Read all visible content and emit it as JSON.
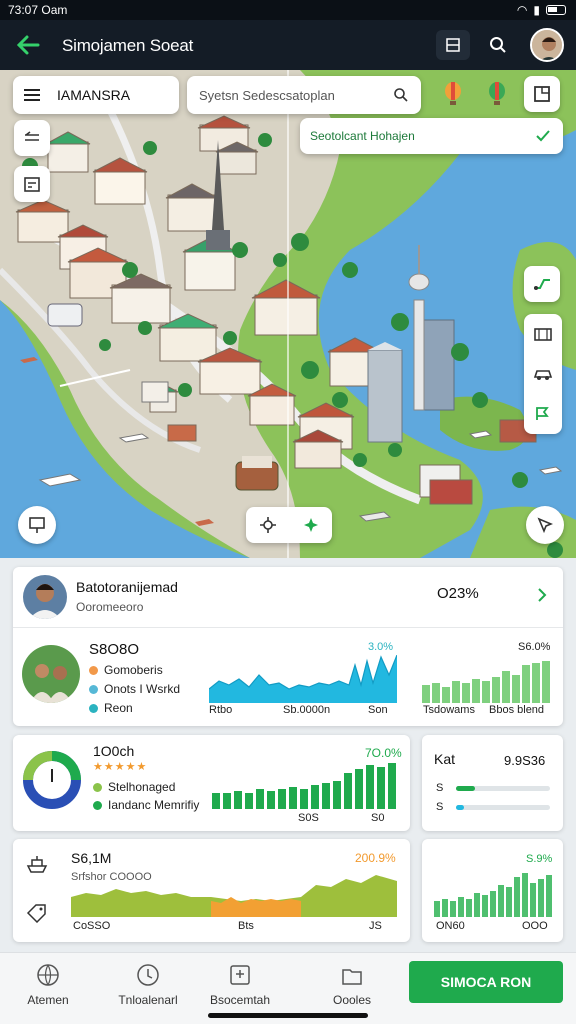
{
  "status_bar": {
    "time": "73:07 Oam",
    "icons": [
      "wifi-icon",
      "signal-icon",
      "battery-icon"
    ]
  },
  "app_bar": {
    "title": "Simojamen Soeat"
  },
  "map": {
    "location_chip": "IAMANSRA",
    "search_placeholder": "Syetsn Sedescsatoplan",
    "notice": "Seotolcant Hohajen"
  },
  "card_profile": {
    "name": "Batotoranijemad",
    "subtitle": "Ooromeeoro",
    "value": "O23%"
  },
  "card_sales": {
    "title": "S8O8O",
    "legend": [
      {
        "label": "Gomoberis",
        "color": "#f2994a"
      },
      {
        "label": "Onots I Wsrkd",
        "color": "#56b8d6"
      },
      {
        "label": "Reon",
        "color": "#2bb3c0"
      }
    ],
    "chart_value": "3.0%",
    "axis": [
      "Rtbo",
      "Sb.0000n",
      "Son"
    ],
    "right_value": "S6.0%",
    "right_axis": [
      "Tsdowams",
      "Bbos blend"
    ]
  },
  "card_goal": {
    "title": "1O0ch",
    "stars": "★★★★★",
    "legend": [
      {
        "label": "Stelhonaged",
        "color": "#8bc34a"
      },
      {
        "label": "Iandanc Memrifiy",
        "color": "#1faa4d"
      }
    ],
    "value": "7O.0%",
    "axis": [
      "S0S",
      "S0"
    ]
  },
  "card_stat": {
    "title": "Kat",
    "value": "9.9S36",
    "rows": [
      {
        "label": "S",
        "progress": 0.2
      },
      {
        "label": "S",
        "progress": 0.08
      }
    ]
  },
  "card_income": {
    "title": "S6,1M",
    "subtitle": "Srfshor COOOO",
    "value": "200.9%",
    "axis": [
      "CoSSO",
      "Bts",
      "JS"
    ]
  },
  "card_trend": {
    "value": "S.9%",
    "axis": [
      "ON60",
      "OOO"
    ]
  },
  "nav": {
    "items": [
      {
        "label": "Atemen",
        "icon": "globe-icon"
      },
      {
        "label": "Tnloalenarl",
        "icon": "clock-icon"
      },
      {
        "label": "Bsocemtah",
        "icon": "map-icon"
      },
      {
        "label": "Oooles",
        "icon": "folder-icon"
      }
    ],
    "cta": "SIMOCA RON"
  },
  "colors": {
    "accent": "#1faa4d",
    "appbar": "#141c26",
    "water": "#5fa8dd",
    "cyan": "#22b8e0"
  }
}
